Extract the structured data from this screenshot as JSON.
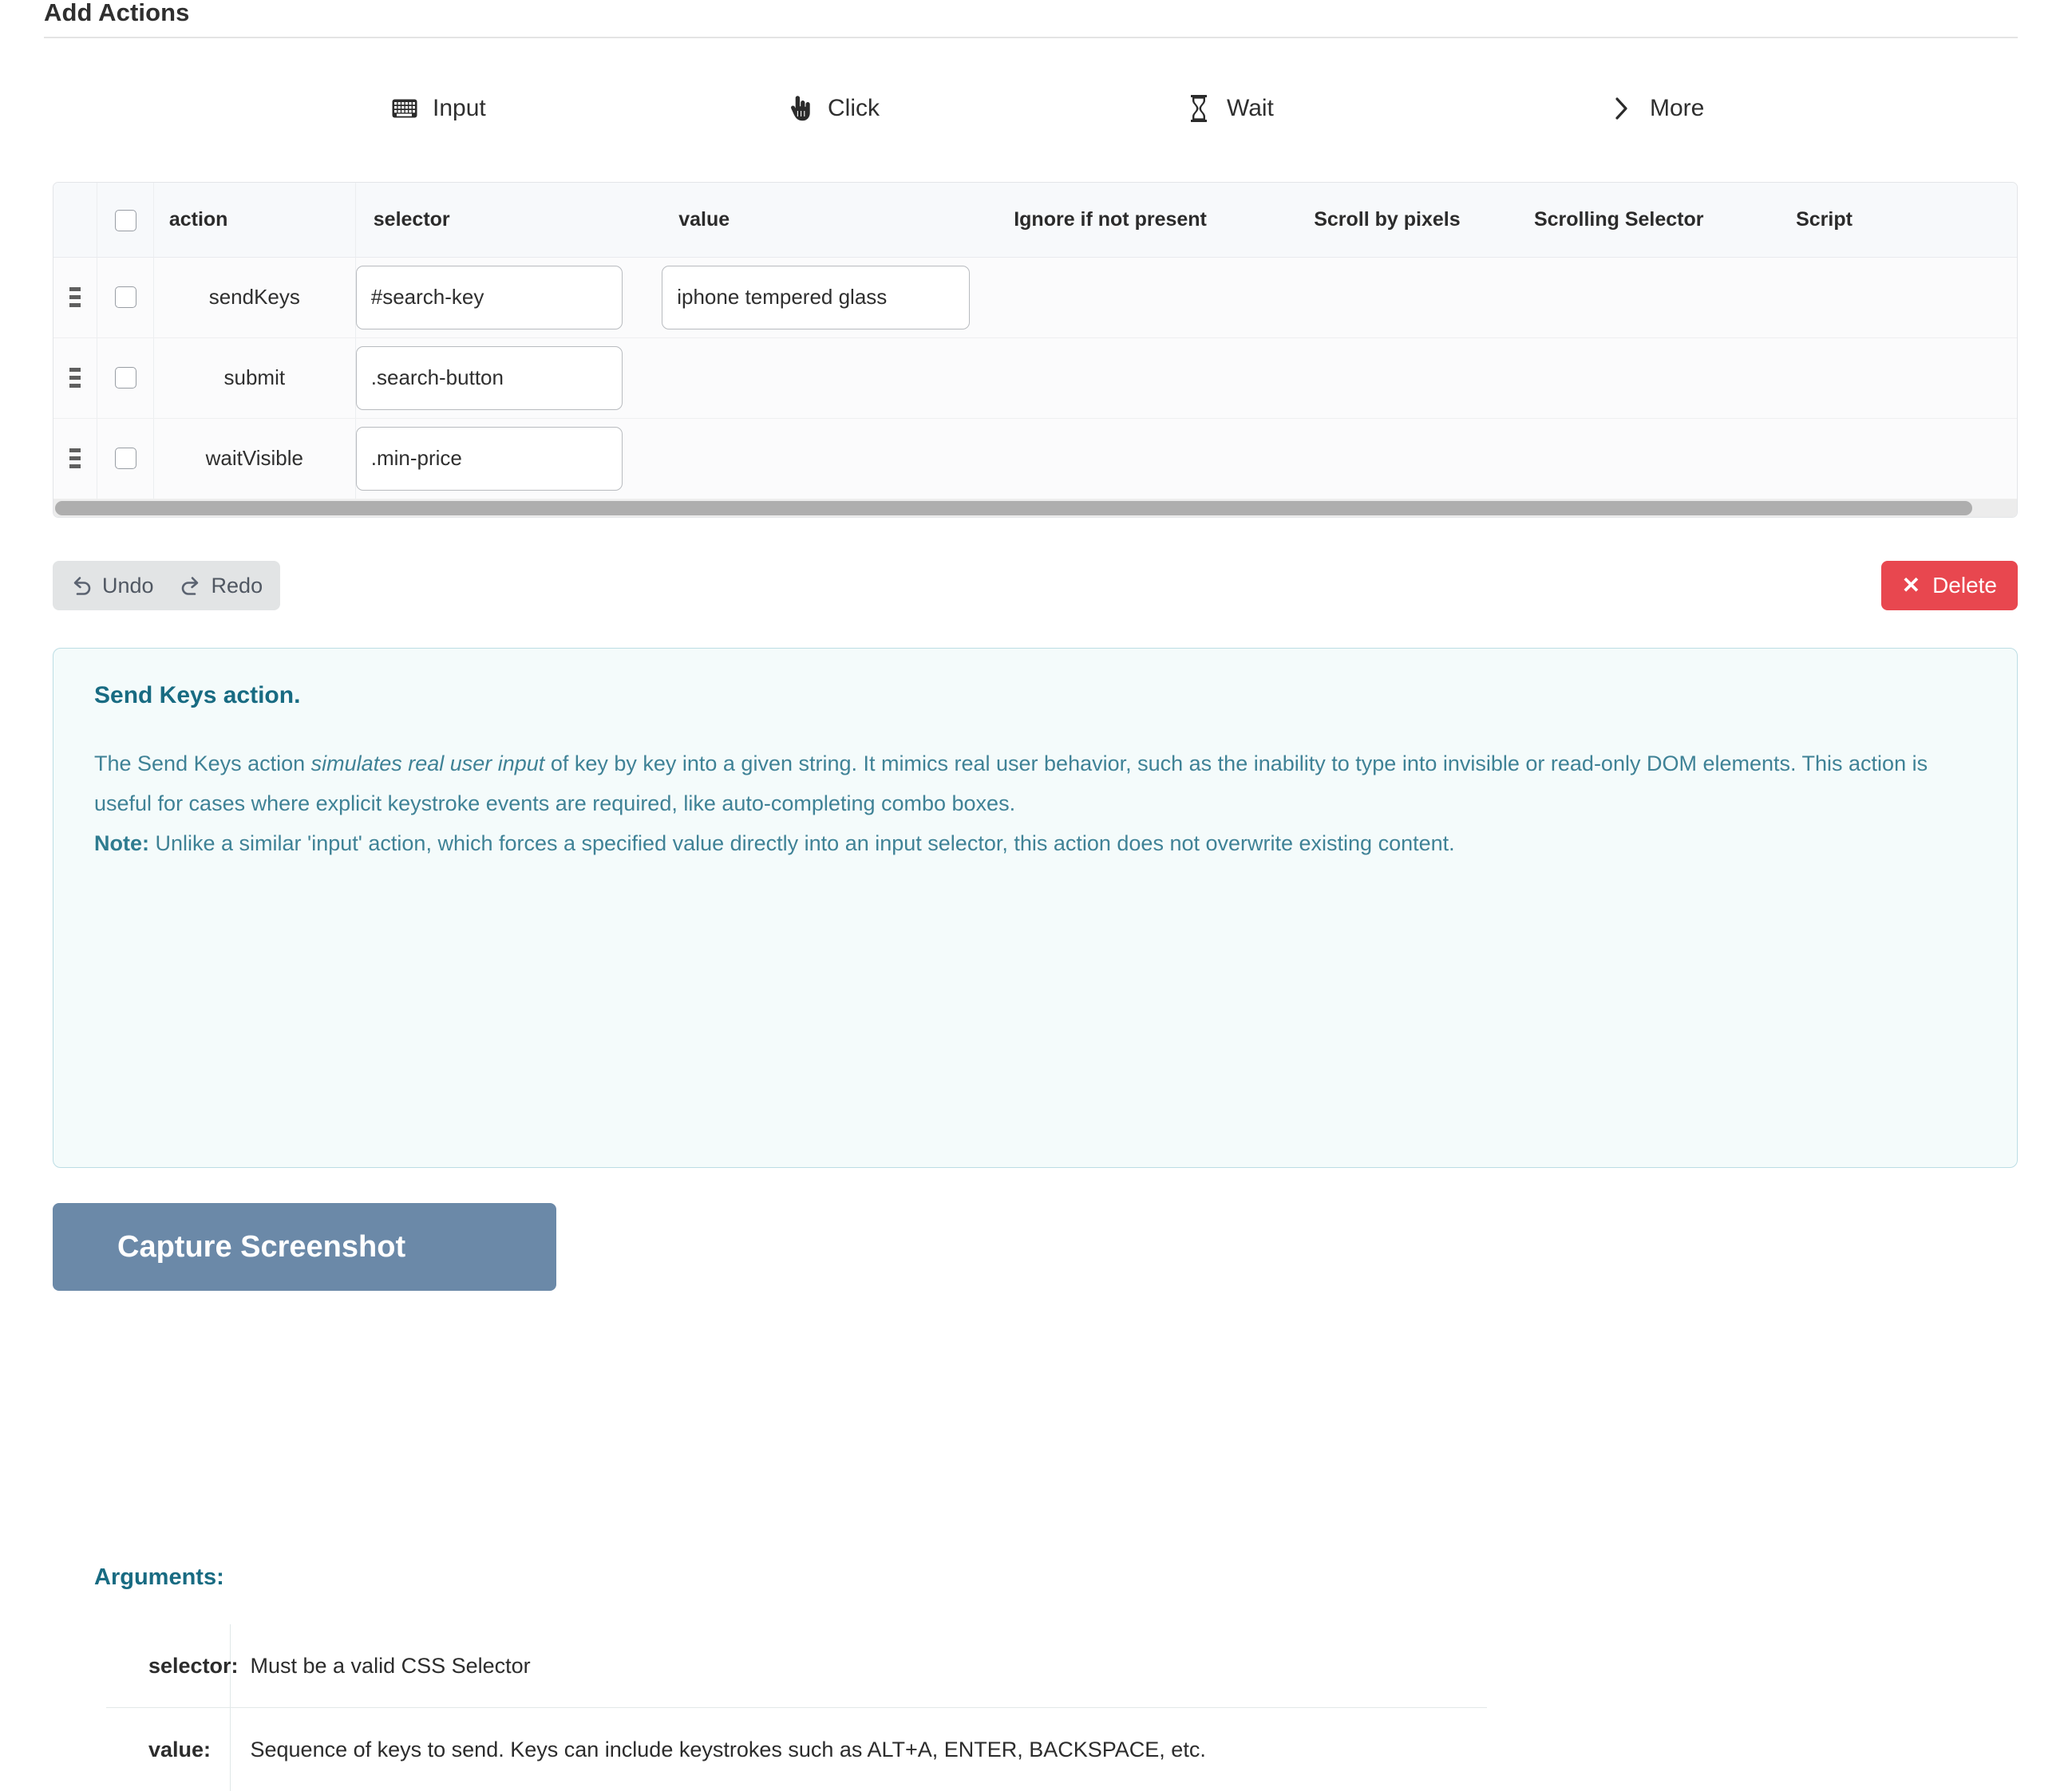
{
  "section": {
    "title": "Add Actions"
  },
  "action_bar": {
    "items": [
      {
        "label": "Input",
        "icon": "keyboard-icon"
      },
      {
        "label": "Click",
        "icon": "hand-pointer-icon"
      },
      {
        "label": "Wait",
        "icon": "hourglass-icon"
      },
      {
        "label": "More",
        "icon": "chevron-right-icon"
      }
    ]
  },
  "table": {
    "columns": [
      "action",
      "selector",
      "value",
      "Ignore if not present",
      "Scroll by pixels",
      "Scrolling Selector",
      "Script"
    ],
    "rows": [
      {
        "action": "sendKeys",
        "selector": "#search-key",
        "value": "iphone tempered glass",
        "ignore_if_not_present": "",
        "scroll_by_pixels": "",
        "scrolling_selector": "",
        "script": ""
      },
      {
        "action": "submit",
        "selector": ".search-button",
        "value": "",
        "ignore_if_not_present": "",
        "scroll_by_pixels": "",
        "scrolling_selector": "",
        "script": ""
      },
      {
        "action": "waitVisible",
        "selector": ".min-price",
        "value": "",
        "ignore_if_not_present": "",
        "scroll_by_pixels": "",
        "scrolling_selector": "",
        "script": ""
      }
    ]
  },
  "toolbar": {
    "undo_label": "Undo",
    "redo_label": "Redo",
    "delete_label": "Delete",
    "delete_icon": "close-x-icon",
    "undo_icon": "undo-arrow-icon",
    "redo_icon": "redo-arrow-icon"
  },
  "info": {
    "title": "Send Keys action.",
    "paragraph_1_a": "The Send Keys action ",
    "paragraph_1_em": "simulates real user input",
    "paragraph_1_b": " of key by key into a given string. It mimics real user behavior, such as the inability to type into invisible or read-only DOM elements. This action is useful for cases where explicit keystroke events are required, like auto-completing combo boxes.",
    "note_label": "Note:",
    "note_text": " Unlike a similar 'input' action, which forces a specified value directly into an input selector, this action does not overwrite existing content.",
    "arguments_title": "Arguments:",
    "arguments": [
      {
        "key": "selector:",
        "desc": "Must be a valid CSS Selector"
      },
      {
        "key": "value:",
        "desc": "Sequence of keys to send. Keys can include keystrokes such as ALT+A, ENTER, BACKSPACE, etc."
      }
    ]
  },
  "capture": {
    "label": "Capture Screenshot"
  },
  "colors": {
    "accent_teal": "#186b82",
    "info_bg": "#f4fbfb",
    "info_border": "#bcdde4",
    "delete_red": "#e8474f",
    "capture_blue": "#6b89a8"
  }
}
